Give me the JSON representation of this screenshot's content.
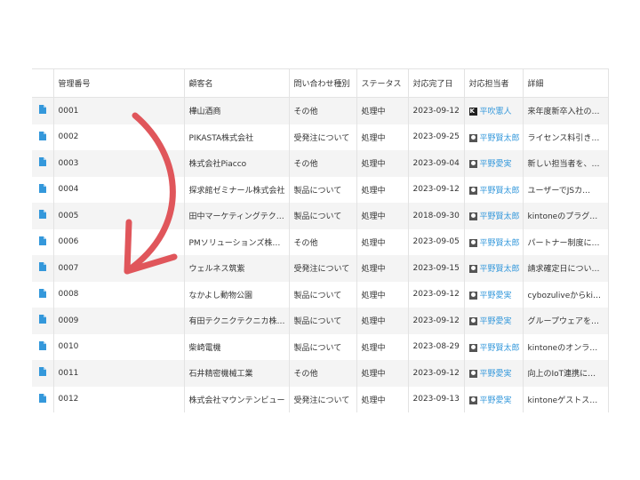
{
  "columns": [
    "",
    "管理番号",
    "顧客名",
    "問い合わせ種別",
    "ステータス",
    "対応完了日",
    "対応担当者",
    "詳細"
  ],
  "rows": [
    {
      "id": "0001",
      "customer": "樺山酒商",
      "type": "その他",
      "status": "処理中",
      "date": "2023-09-12",
      "assignee": "平吹憲人",
      "detail": "来年度新卒入社の…"
    },
    {
      "id": "0002",
      "customer": "PIKASTA株式会社",
      "type": "受発注について",
      "status": "処理中",
      "date": "2023-09-25",
      "assignee": "平野賢太郎",
      "detail": "ライセンス料引き…"
    },
    {
      "id": "0003",
      "customer": "株式会社Piacco",
      "type": "その他",
      "status": "処理中",
      "date": "2023-09-04",
      "assignee": "平野愛実",
      "detail": "新しい担当者を、…"
    },
    {
      "id": "0004",
      "customer": "探求館ゼミナール株式会社",
      "type": "製品について",
      "status": "処理中",
      "date": "2023-09-12",
      "assignee": "平野賢太郎",
      "detail": "ユーザーでJSカ…"
    },
    {
      "id": "0005",
      "customer": "田中マーケティングテク…",
      "type": "製品について",
      "status": "処理中",
      "date": "2018-09-30",
      "assignee": "平野賢太郎",
      "detail": "kintoneのプラグ…"
    },
    {
      "id": "0006",
      "customer": "PMソリューションズ株…",
      "type": "その他",
      "status": "処理中",
      "date": "2023-09-05",
      "assignee": "平野賢太郎",
      "detail": "パートナー制度に…"
    },
    {
      "id": "0007",
      "customer": "ウェルネス筑紫",
      "type": "受発注について",
      "status": "処理中",
      "date": "2023-09-15",
      "assignee": "平野賢太郎",
      "detail": "請求確定日につい…"
    },
    {
      "id": "0008",
      "customer": "なかよし動物公園",
      "type": "製品について",
      "status": "処理中",
      "date": "2023-09-12",
      "assignee": "平野愛実",
      "detail": "cybozuliveからki…"
    },
    {
      "id": "0009",
      "customer": "有田テクニクテクニカ株…",
      "type": "製品について",
      "status": "処理中",
      "date": "2023-09-12",
      "assignee": "平野愛実",
      "detail": "グループウェアを…"
    },
    {
      "id": "0010",
      "customer": "柴崎電機",
      "type": "製品について",
      "status": "処理中",
      "date": "2023-08-29",
      "assignee": "平野賢太郎",
      "detail": "kintoneのオンラ…"
    },
    {
      "id": "0011",
      "customer": "石井精密機械工業",
      "type": "その他",
      "status": "処理中",
      "date": "2023-09-12",
      "assignee": "平野愛実",
      "detail": "向上のIoT連携に…"
    },
    {
      "id": "0012",
      "customer": "株式会社マウンテンビュー",
      "type": "受発注について",
      "status": "処理中",
      "date": "2023-09-13",
      "assignee": "平野愛実",
      "detail": "kintoneゲストス…"
    }
  ],
  "colors": {
    "accent": "#3498db",
    "arrow": "#e0565b",
    "stripe": "#f4f4f4",
    "border": "#e3e3e3"
  },
  "icons": {
    "row_icon": "document-icon",
    "avatar": "user-avatar-icon",
    "annotation": "curved-arrow"
  }
}
